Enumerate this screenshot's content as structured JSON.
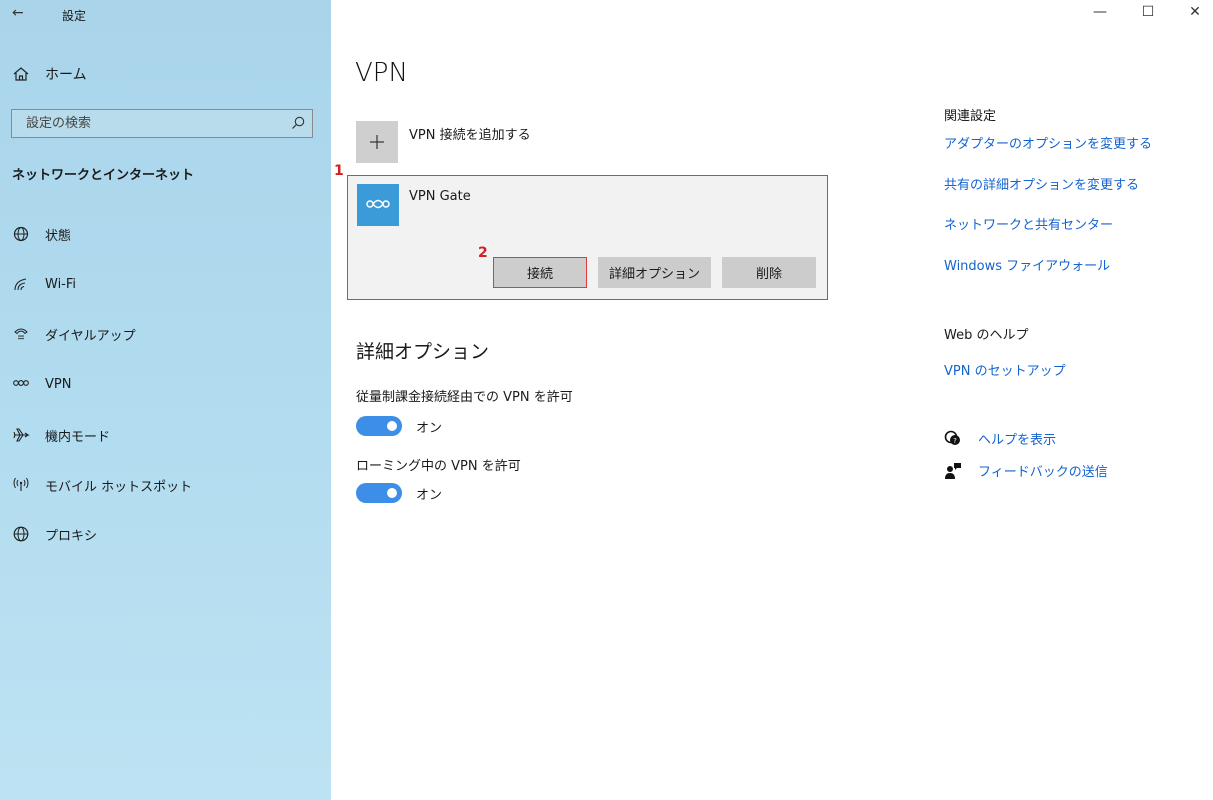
{
  "window": {
    "title": "設定",
    "back_glyph": "←",
    "minimize_glyph": "—",
    "maximize_glyph": "☐",
    "close_glyph": "✕"
  },
  "sidebar": {
    "home_label": "ホーム",
    "search_placeholder": "設定の検索",
    "section_label": "ネットワークとインターネット",
    "items": [
      {
        "label": "状態",
        "icon": "globe-status-icon"
      },
      {
        "label": "Wi-Fi",
        "icon": "wifi-icon"
      },
      {
        "label": "ダイヤルアップ",
        "icon": "dialup-icon"
      },
      {
        "label": "VPN",
        "icon": "vpn-icon"
      },
      {
        "label": "機内モード",
        "icon": "airplane-icon"
      },
      {
        "label": "モバイル ホットスポット",
        "icon": "hotspot-icon"
      },
      {
        "label": "プロキシ",
        "icon": "proxy-globe-icon"
      }
    ]
  },
  "main": {
    "title": "VPN",
    "add_vpn_label": "VPN 接続を追加する",
    "vpn_connection": {
      "name": "VPN Gate",
      "connect_label": "接続",
      "advanced_label": "詳細オプション",
      "delete_label": "削除"
    },
    "markers": {
      "card": "1",
      "connect": "2"
    },
    "advanced": {
      "title": "詳細オプション",
      "metered_label": "従量制課金接続経由での VPN を許可",
      "metered_state": "オン",
      "roaming_label": "ローミング中の VPN を許可",
      "roaming_state": "オン"
    }
  },
  "right_panel": {
    "related_title": "関連設定",
    "related_links": [
      "アダプターのオプションを変更する",
      "共有の詳細オプションを変更する",
      "ネットワークと共有センター",
      "Windows ファイアウォール"
    ],
    "web_help_title": "Web のヘルプ",
    "web_help_link": "VPN のセットアップ",
    "help_label": "ヘルプを表示",
    "feedback_label": "フィードバックの送信"
  },
  "colors": {
    "accent": "#3d8ee6",
    "link": "#1463cf",
    "highlight": "#e23a3a",
    "sidebar_bg": "#b2dcef"
  }
}
